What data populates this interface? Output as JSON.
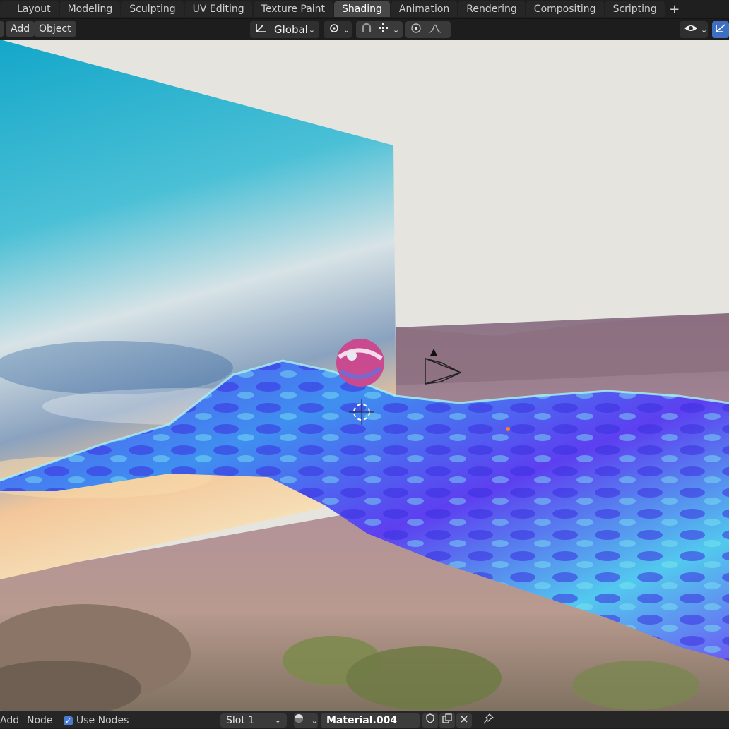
{
  "workspace_tabs": [
    {
      "label": "Layout"
    },
    {
      "label": "Modeling"
    },
    {
      "label": "Sculpting"
    },
    {
      "label": "UV Editing"
    },
    {
      "label": "Texture Paint"
    },
    {
      "label": "Shading",
      "active": true
    },
    {
      "label": "Animation"
    },
    {
      "label": "Rendering"
    },
    {
      "label": "Compositing"
    },
    {
      "label": "Scripting"
    }
  ],
  "add_tab_symbol": "+",
  "header": {
    "add_label": "Add",
    "object_label": "Object",
    "transform_orientation": "Global"
  },
  "bottom": {
    "add_label": "Add",
    "node_label": "Node",
    "use_nodes_label": "Use Nodes",
    "slot_label": "Slot 1",
    "material_name": "Material.004"
  },
  "icons": {
    "orientation": "orientation-icon",
    "pivot": "pivot-icon",
    "snap": "snap-icon",
    "snap_increment": "snap-increment-icon",
    "proportional": "proportional-edit-icon",
    "falloff": "falloff-icon",
    "visibility": "eye-icon",
    "gizmo": "gizmo-icon",
    "material_sphere": "material-sphere-icon",
    "fake_user": "shield-icon",
    "duplicate": "duplicate-icon",
    "unlink": "close-icon",
    "pin": "pin-icon"
  },
  "colors": {
    "active_tab": "#474747",
    "accent_blue": "#4a7bd1",
    "water_blue": "#4a3cf0",
    "water_cyan": "#5fe3e8",
    "sky_panel": "#2ab3d4"
  }
}
